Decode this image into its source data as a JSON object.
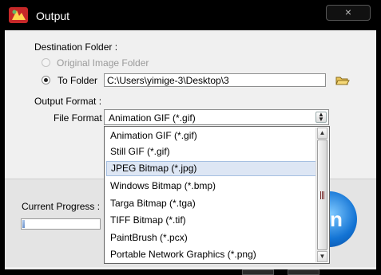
{
  "window": {
    "title": "Output",
    "close_symbol": "×"
  },
  "destination": {
    "label": "Destination Folder :",
    "original_option": "Original Image Folder",
    "to_folder_option": "To Folder",
    "path_value": "C:\\Users\\yimige-3\\Desktop\\3"
  },
  "output_format": {
    "label": "Output Format :",
    "file_format_label": "File Format",
    "selected": "Animation GIF (*.gif)",
    "options": [
      "Animation GIF (*.gif)",
      "Still GIF (*.gif)",
      "JPEG Bitmap (*.jpg)",
      "Windows Bitmap (*.bmp)",
      "Targa Bitmap (*.tga)",
      "TIFF Bitmap (*.tif)",
      "PaintBrush (*.pcx)",
      "Portable Network Graphics (*.png)"
    ],
    "highlighted_index": 2
  },
  "progress": {
    "label": "Current Progress :",
    "value_fraction": 0.03
  },
  "start_button": {
    "partial_text": "n"
  },
  "colors": {
    "accent": "#1273d4",
    "highlight": "#dde6f4",
    "titlebar": "#000000"
  },
  "icons": {
    "app": "app-logo-icon",
    "folder": "folder-open-icon"
  }
}
